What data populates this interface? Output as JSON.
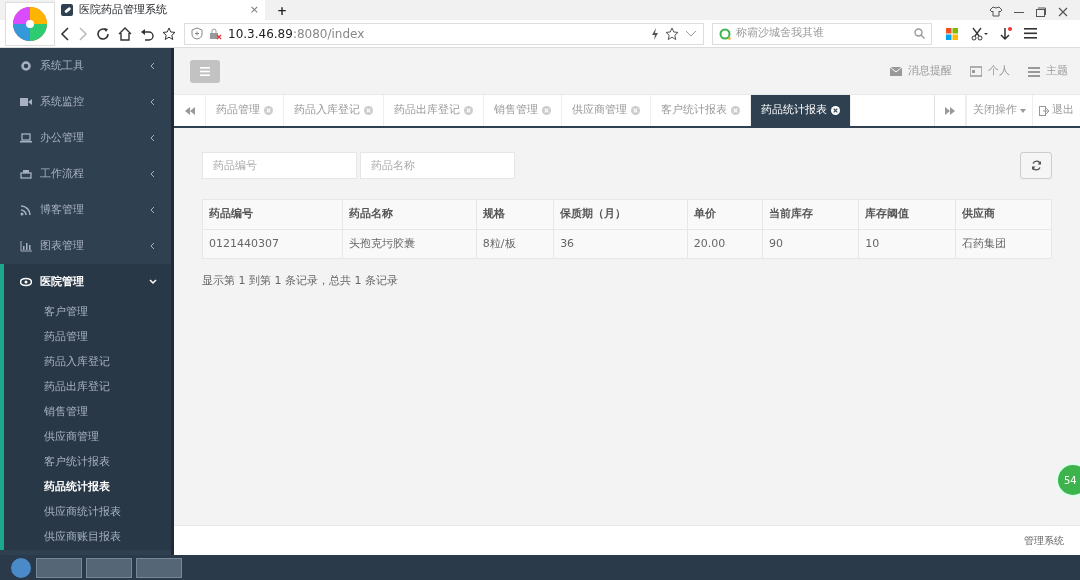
{
  "browser": {
    "tab_title": "医院药品管理系统",
    "tab_close": "×",
    "new_tab": "+",
    "url_host": "10.3.46.89",
    "url_rest": ":8080/index",
    "search_placeholder": "称霸沙城舍我其谁"
  },
  "sidebar": {
    "items": [
      {
        "label": "系统工具",
        "expanded": false
      },
      {
        "label": "系统监控",
        "expanded": false
      },
      {
        "label": "办公管理",
        "expanded": false
      },
      {
        "label": "工作流程",
        "expanded": false
      },
      {
        "label": "博客管理",
        "expanded": false
      },
      {
        "label": "图表管理",
        "expanded": false
      },
      {
        "label": "医院管理",
        "expanded": true,
        "children": [
          {
            "label": "客户管理",
            "selected": false
          },
          {
            "label": "药品管理",
            "selected": false
          },
          {
            "label": "药品入库登记",
            "selected": false
          },
          {
            "label": "药品出库登记",
            "selected": false
          },
          {
            "label": "销售管理",
            "selected": false
          },
          {
            "label": "供应商管理",
            "selected": false
          },
          {
            "label": "客户统计报表",
            "selected": false
          },
          {
            "label": "药品统计报表",
            "selected": true
          },
          {
            "label": "供应商统计报表",
            "selected": false
          },
          {
            "label": "供应商账目报表",
            "selected": false
          }
        ]
      }
    ]
  },
  "header": {
    "actions": [
      {
        "label": "消息提醒"
      },
      {
        "label": "个人"
      },
      {
        "label": "主题"
      }
    ]
  },
  "tabs": [
    {
      "label": "药品管理",
      "selected": false
    },
    {
      "label": "药品入库登记",
      "selected": false
    },
    {
      "label": "药品出库登记",
      "selected": false
    },
    {
      "label": "销售管理",
      "selected": false
    },
    {
      "label": "供应商管理",
      "selected": false
    },
    {
      "label": "客户统计报表",
      "selected": false
    },
    {
      "label": "药品统计报表",
      "selected": true
    }
  ],
  "tab_tools": {
    "close_menu": "关闭操作",
    "logout": "退出"
  },
  "search": {
    "fields": [
      {
        "placeholder": "药品编号"
      },
      {
        "placeholder": "药品名称"
      }
    ]
  },
  "table": {
    "columns": [
      "药品编号",
      "药品名称",
      "规格",
      "保质期（月）",
      "单价",
      "当前库存",
      "库存阈值",
      "供应商"
    ],
    "rows": [
      [
        "0121440307",
        "头孢克圬胶囊",
        "8粒/板",
        "36",
        "20.00",
        "90",
        "10",
        "石药集团"
      ]
    ]
  },
  "pagination_info": "显示第 1 到第 1 条记录，总共 1 条记录",
  "footer": "管理系统",
  "floating_badge": "54"
}
